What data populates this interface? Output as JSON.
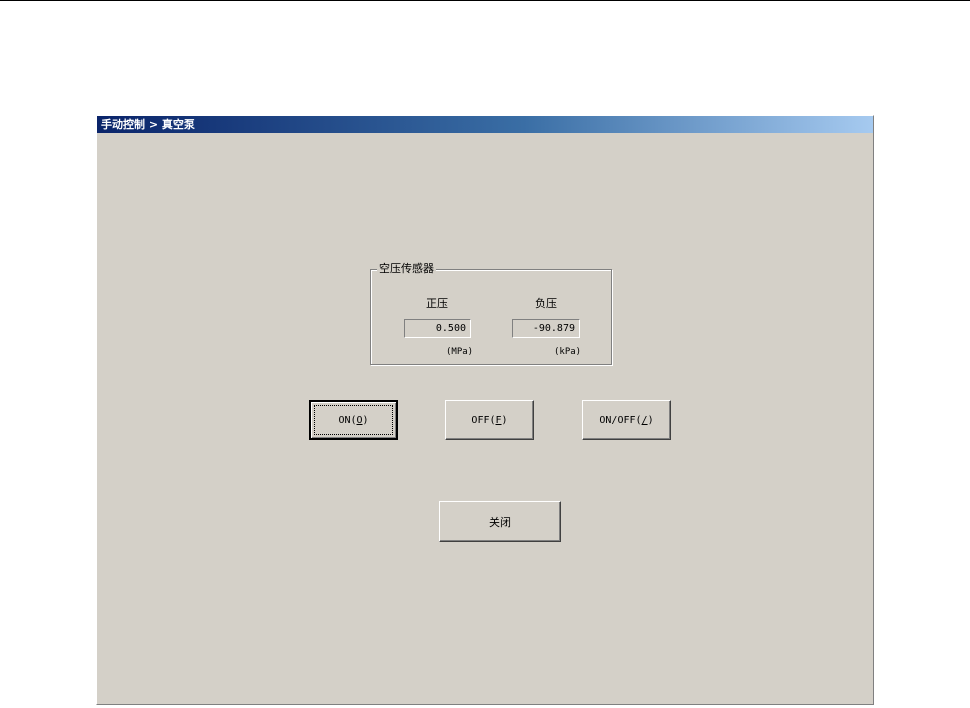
{
  "window": {
    "title": "手动控制 > 真空泵"
  },
  "sensor_group": {
    "label": "空压传感器",
    "positive": {
      "header": "正压",
      "value": "0.500",
      "unit": "(MPa)"
    },
    "negative": {
      "header": "负压",
      "value": "-90.879",
      "unit": "(kPa)"
    }
  },
  "buttons": {
    "on": {
      "pre": "ON(",
      "key": "O",
      "post": ")"
    },
    "off": {
      "pre": "OFF(",
      "key": "F",
      "post": ")"
    },
    "onoff": {
      "pre": "ON/OFF(",
      "key": "/",
      "post": ")"
    },
    "close": "关闭"
  },
  "colors": {
    "window_bg": "#d4d0c8",
    "title_start": "#0a246a",
    "title_end": "#a6caf0"
  }
}
